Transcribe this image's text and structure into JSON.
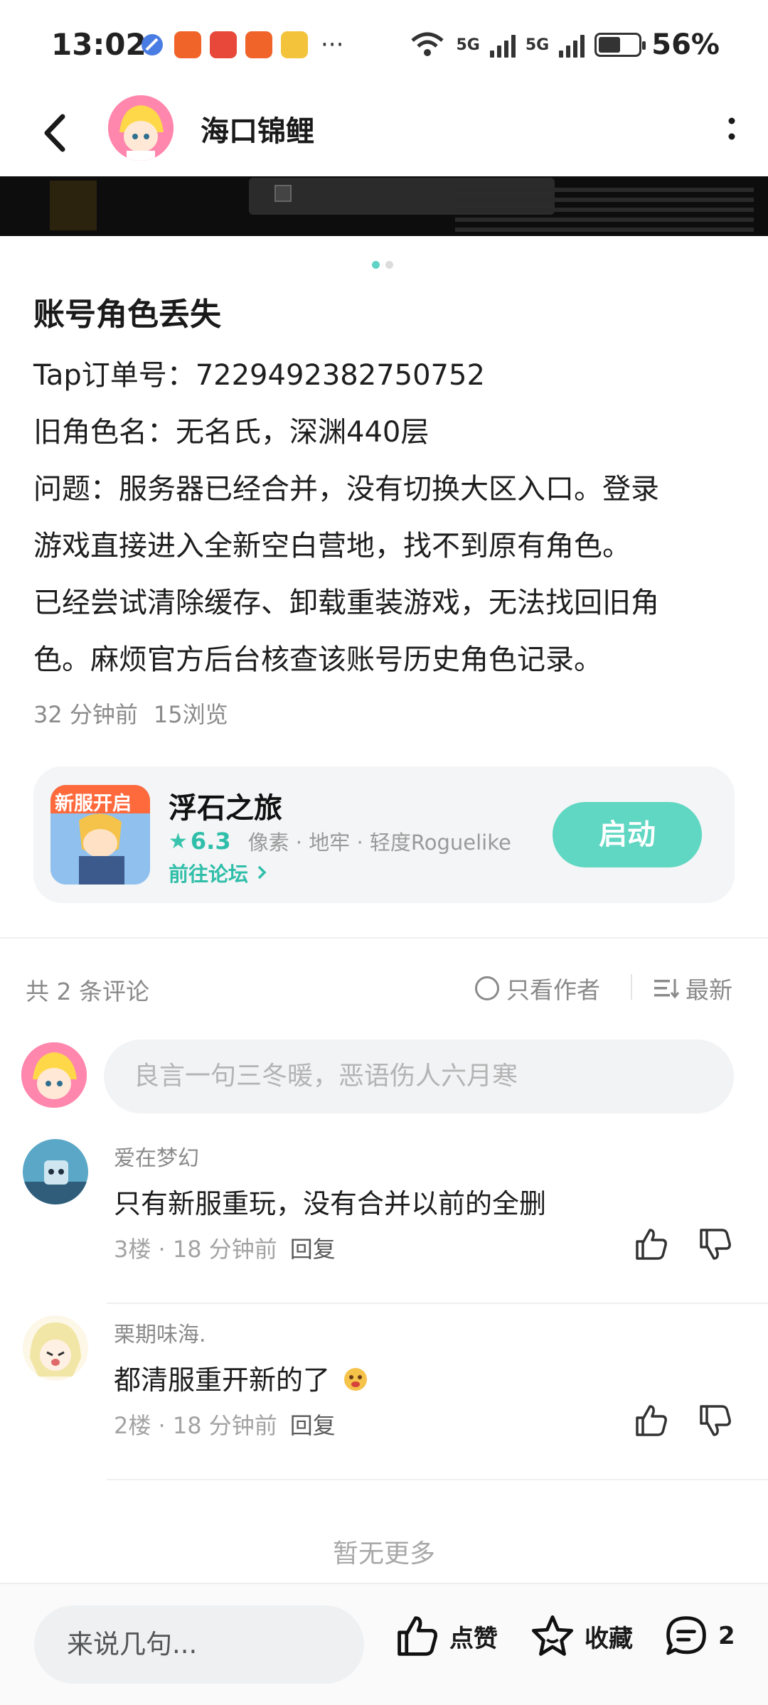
{
  "status_bar": {
    "time": "13:02",
    "more": "···",
    "network_1": "5G",
    "network_2": "5G",
    "battery": "56%",
    "battery_level": 0.56
  },
  "header": {
    "title": "海口锦鲤"
  },
  "post": {
    "title": "账号角色丢失",
    "lines": [
      "Tap订单号：7229492382750752",
      "旧角色名：无名氏，深渊440层",
      "问题：服务器已经合并，没有切换大区入口。登录",
      "游戏直接进入全新空白营地，找不到原有角色。",
      "已经尝试清除缓存、卸载重装游戏，无法找回旧角",
      "色。麻烦官方后台核查该账号历史角色记录。"
    ],
    "time_ago": "32 分钟前",
    "views": "15浏览"
  },
  "game": {
    "name": "浮石之旅",
    "rating": "6.3",
    "tags": "像素 · 地牢 · 轻度Roguelike",
    "forum_link": "前往论坛",
    "launch_label": "启动",
    "icon_badge": "新服开启"
  },
  "comments_header": {
    "count": "共 2 条评论",
    "only_author": "只看作者",
    "sort": "最新"
  },
  "comment_input": {
    "placeholder": "良言一句三冬暖，恶语伤人六月寒"
  },
  "comments": [
    {
      "user": "爱在梦幻",
      "text": "只有新服重玩，没有合并以前的全删",
      "floor": "3楼",
      "time": "18 分钟前",
      "reply": "回复"
    },
    {
      "user": "栗期味海.",
      "text": "都清服重开新的了",
      "floor": "2楼",
      "time": "18 分钟前",
      "reply": "回复"
    }
  ],
  "no_more": "暂无更多",
  "bottom_bar": {
    "say_placeholder": "来说几句...",
    "like_label": "点赞",
    "fav_label": "收藏",
    "comment_count": "2"
  },
  "colors": {
    "accent": "#5fd7c2",
    "accent_text": "#2fbea9"
  }
}
